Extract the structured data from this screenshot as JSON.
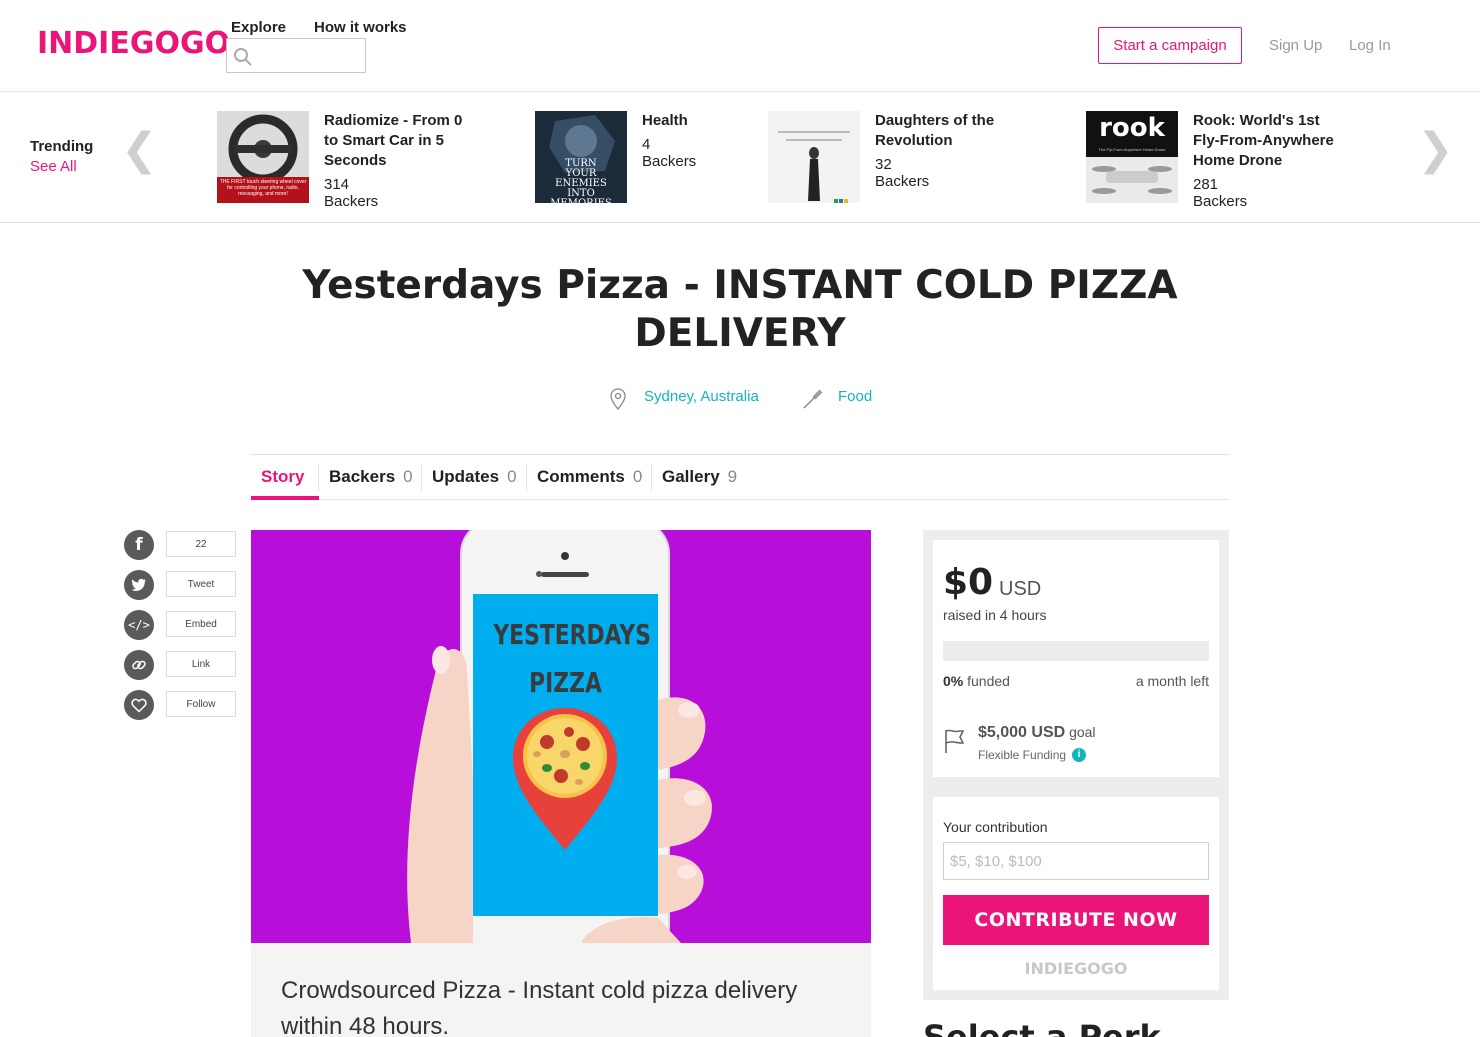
{
  "header": {
    "logo": "INDIEGOGO",
    "nav": [
      "Explore",
      "How it works"
    ],
    "search_placeholder": "",
    "start_campaign": "Start a campaign",
    "sign_up": "Sign Up",
    "log_in": "Log In"
  },
  "trending": {
    "title": "Trending",
    "see_all": "See All",
    "items": [
      {
        "name": "Radiomize - From 0 to Smart Car in 5 Seconds",
        "backers": "314 Backers"
      },
      {
        "name": "Health",
        "backers": "4 Backers"
      },
      {
        "name": "Daughters of the Revolution",
        "backers": "32 Backers"
      },
      {
        "name": "Rook: World's 1st Fly-From-Anywhere Home Drone",
        "backers": "281 Backers"
      }
    ],
    "thumb_captions": {
      "radiomize": "THE FIRST touch steering wheel cover for controlling your phone, radio, messaging, and more!",
      "health": "TURN YOUR ENEMIES INTO MEMORIES",
      "rook": "rook",
      "rook_sub": "The Fly-From-Anywhere Home Drone"
    }
  },
  "campaign": {
    "title": "Yesterdays Pizza - INSTANT COLD PIZZA DELIVERY",
    "location": "Sydney, Australia",
    "category": "Food",
    "tagline": "Crowdsourced Pizza - Instant cold pizza delivery within 48 hours.",
    "hero_text_1": "YESTERDAYS",
    "hero_text_2": "PIZZA"
  },
  "tabs": [
    {
      "label": "Story",
      "count": ""
    },
    {
      "label": "Backers",
      "count": "0"
    },
    {
      "label": "Updates",
      "count": "0"
    },
    {
      "label": "Comments",
      "count": "0"
    },
    {
      "label": "Gallery",
      "count": "9"
    }
  ],
  "share": [
    {
      "icon": "facebook-icon",
      "label": "22"
    },
    {
      "icon": "twitter-icon",
      "label": "Tweet"
    },
    {
      "icon": "embed-icon",
      "label": "Embed"
    },
    {
      "icon": "link-icon",
      "label": "Link"
    },
    {
      "icon": "heart-icon",
      "label": "Follow"
    }
  ],
  "funding": {
    "amount": "$0",
    "currency": "USD",
    "raised_text": "raised in 4 hours",
    "percent_label": "0%",
    "funded_label": "funded",
    "progress_fraction": 0,
    "time_left": "a month left",
    "goal_amount": "$5,000 USD",
    "goal_label": "goal",
    "funding_type": "Flexible Funding",
    "contribution_label": "Your contribution",
    "contribution_placeholder": "$5, $10, $100",
    "contribute_button": "CONTRIBUTE NOW",
    "footer_logo": "INDIEGOGO"
  },
  "perks": {
    "heading": "Select a Perk"
  },
  "colors": {
    "brand": "#eb1478",
    "accent": "#15b4bd",
    "hero_bg": "#b70ed9"
  }
}
